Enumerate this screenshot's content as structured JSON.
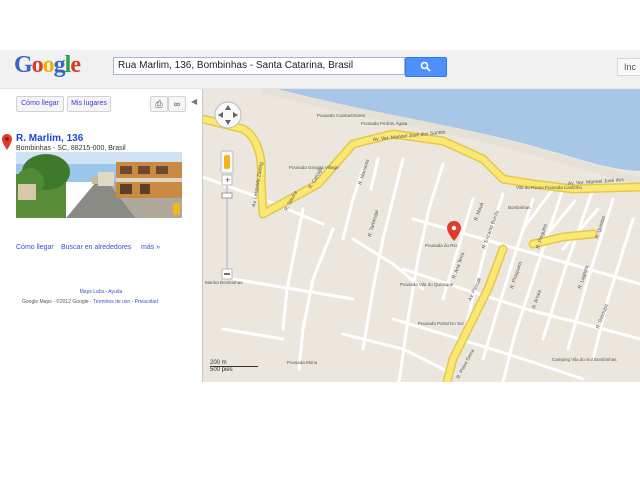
{
  "logo": {
    "letters": [
      "G",
      "o",
      "o",
      "g",
      "l",
      "e"
    ]
  },
  "search": {
    "value": "Rua Marlim, 136, Bombinhas - Santa Catarina, Brasil"
  },
  "topbar": {
    "right_label": "Inc"
  },
  "toolbar": {
    "directions_label": "Cómo llegar",
    "my_places_label": "Mis lugares"
  },
  "place": {
    "title": "R. Marlim, 136",
    "address": "Bombinhas - SC, 88215-000, Brasil",
    "links": {
      "directions": "Cómo llegar",
      "search_nearby": "Buscar en alrededores",
      "more": "más »"
    }
  },
  "footer": {
    "line1": "Maps Labs - Ayuda",
    "copyright": "Google Maps - ©2012 Google - ",
    "terms": "Términos de uso",
    "separator": " - ",
    "privacy": "Privacidad"
  },
  "map": {
    "streets": [
      "Av. Ver. Manoel José dos Santos",
      "Av. Ver. Manoel José dos",
      "Av. Leopoldo Zarling",
      "R. Tatuíra",
      "R. Carcaju",
      "R. Mariscos",
      "R. Tartaruga",
      "R. Mauá",
      "R. Encanto Bonito",
      "R. Ana Terra",
      "Av. Pascali",
      "R. Peixe Serra",
      "R. Piraquara",
      "R. Pinguins",
      "R. Arraia",
      "R. Lagosta",
      "R. Garoupa",
      "R. Quintas"
    ],
    "pois": [
      "Pousada Caiobasmares",
      "Pousada Geogas Village",
      "Pousada Pedras Ágata",
      "Vila do Pouso Pousada Cantinho",
      "Pousada do Rio",
      "Bombinhas",
      "Pousada Vila do Quiosque",
      "Pousada Portal Do Sol",
      "Camping Vila do Sol Bombinhas",
      "Pousada Morio",
      "Marina Bombinhas"
    ],
    "scale": {
      "metric": "200 m",
      "imperial": "500 pies"
    },
    "colors": {
      "land": "#ebe7de",
      "water": "#a8c6e6",
      "major_road": "#fbe773",
      "road": "#ffffff"
    }
  }
}
